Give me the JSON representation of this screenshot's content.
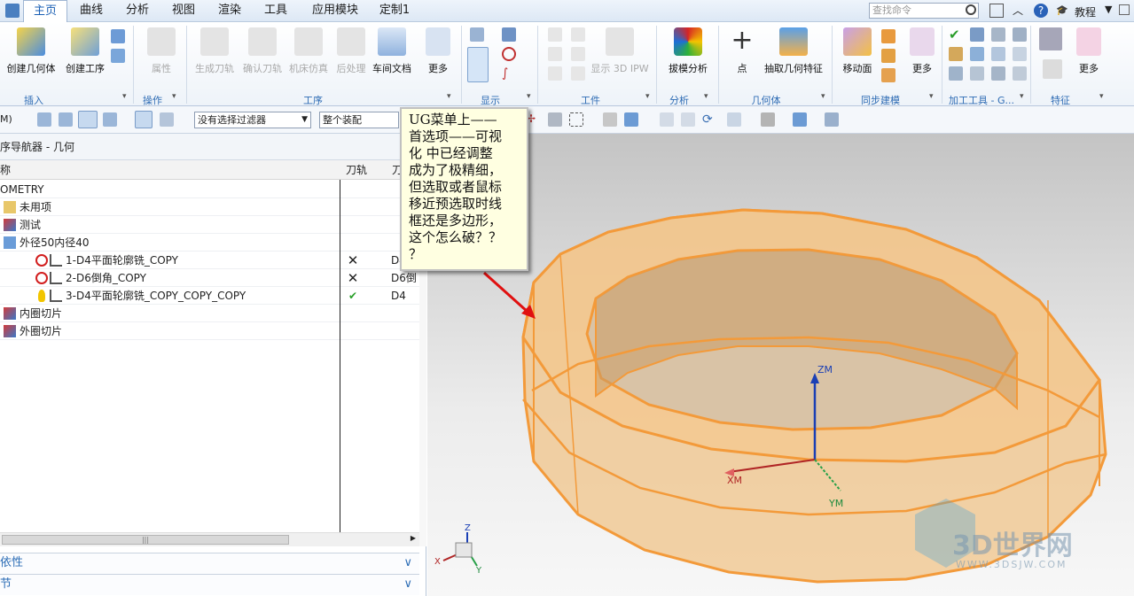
{
  "menu": {
    "tabs": [
      "主页",
      "曲线",
      "分析",
      "视图",
      "渲染",
      "工具",
      "应用模块",
      "定制1"
    ],
    "active_tab": "主页",
    "search_placeholder": "查找命令",
    "tutorial": "教程"
  },
  "ribbon": {
    "buttons": {
      "create_geometry": "创建几何体",
      "create_operation": "创建工序",
      "properties": "属性",
      "generate_toolpath": "生成刀轨",
      "verify_toolpath": "确认刀轨",
      "machine_sim": "机床仿真",
      "postprocess": "后处理",
      "shop_doc": "车间文档",
      "more1": "更多",
      "show_3d_ipw": "显示 3D IPW",
      "draft_analysis": "拔模分析",
      "point": "点",
      "extract_geometry": "抽取几何特征",
      "move_face": "移动面",
      "more2": "更多",
      "more3": "更多"
    },
    "groups": {
      "insert": "插入",
      "actions": "操作",
      "operations": "工序",
      "display": "显示",
      "workpiece": "工件",
      "analysis": "分析",
      "geometry": "几何体",
      "sync_modeling": "同步建模",
      "machining_tools": "加工工具 - G...",
      "features": "特征"
    }
  },
  "toolbar": {
    "mode": "M)",
    "filter": "没有选择过滤器",
    "scope": "整个装配"
  },
  "navigator": {
    "title": "序导航器 - 几何",
    "col_name": "称",
    "col_path": "刀轨",
    "col_tool": "刀",
    "rows": [
      {
        "name": "OMETRY",
        "path": "",
        "tool": ""
      },
      {
        "name": "未用项",
        "path": "",
        "tool": ""
      },
      {
        "name": "测试",
        "path": "",
        "tool": ""
      },
      {
        "name": "外径50内径40",
        "path": "",
        "tool": ""
      },
      {
        "name": "1-D4平面轮廓铣_COPY",
        "path": "✕",
        "tool": "D4"
      },
      {
        "name": "2-D6倒角_COPY",
        "path": "✕",
        "tool": "D6倒"
      },
      {
        "name": "3-D4平面轮廓铣_COPY_COPY_COPY",
        "path": "✔",
        "tool": "D4"
      },
      {
        "name": "内圈切片",
        "path": "",
        "tool": ""
      },
      {
        "name": "外圈切片",
        "path": "",
        "tool": ""
      }
    ],
    "panels": [
      "依性",
      "节"
    ]
  },
  "viewport": {
    "axis_labels": {
      "z": "ZM",
      "x": "XM",
      "y": "YM"
    },
    "triad_labels": {
      "z": "Z",
      "x": "X",
      "y": "Y"
    },
    "callout": [
      "UG菜单上——",
      "首选项——可视",
      "化 中已经调整",
      "成为了极精细，",
      "但选取或者鼠标",
      "移近预选取时线",
      "框还是多边形，",
      "这个怎么破？？",
      "？"
    ],
    "watermark_title": "3D世界网",
    "watermark_url": "WWW.3DSJW.COM"
  }
}
